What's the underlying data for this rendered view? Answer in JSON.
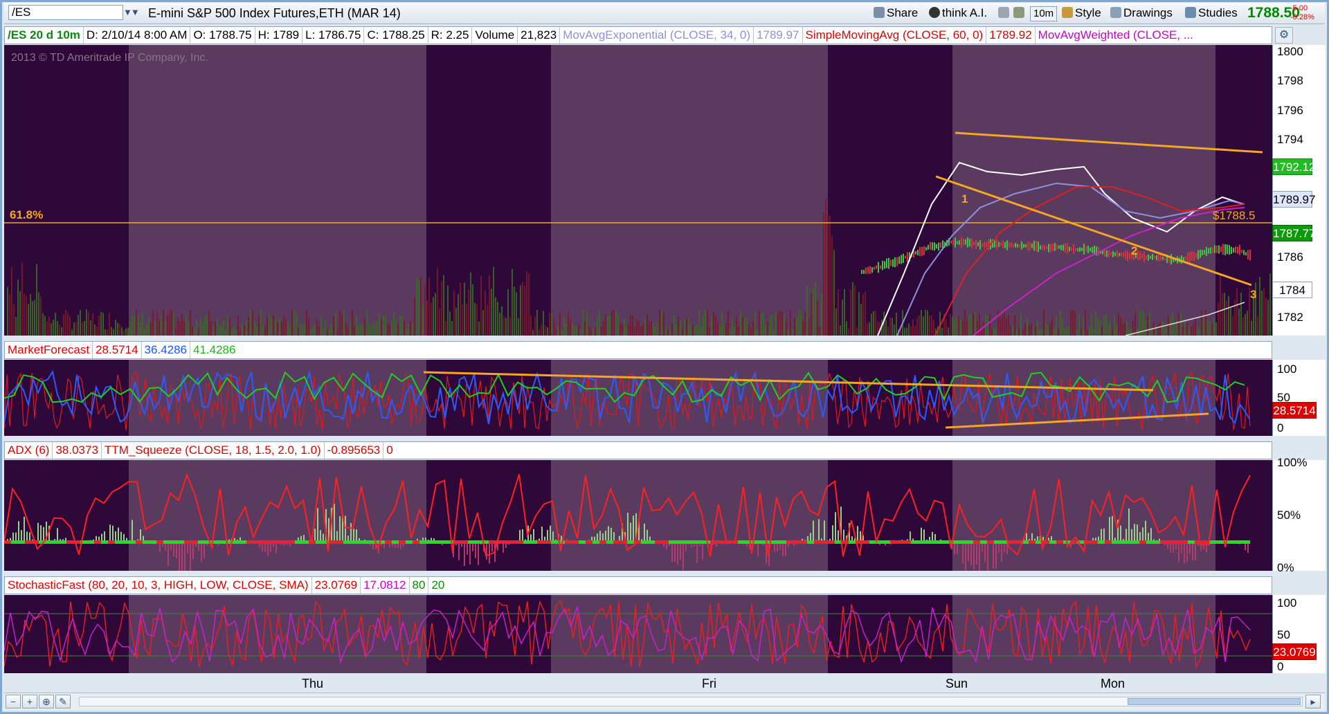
{
  "toolbar": {
    "symbol": "/ES",
    "instrument_title": "E-mini S&P 500 Index Futures,ETH (MAR 14)",
    "share_label": "Share",
    "think_ai_label": "think A.I.",
    "period_label": "10m",
    "style_label": "Style",
    "drawings_label": "Drawings",
    "studies_label": "Studies",
    "last_price": "1788.50",
    "net_change": "-5.00",
    "pct_change": "-0.28%"
  },
  "info_row": {
    "chart_id": "/ES 20 d 10m",
    "date": "D: 2/10/14 8:00 AM",
    "open": "O: 1788.75",
    "high": "H: 1789",
    "low": "L: 1786.75",
    "close": "C: 1788.25",
    "range": "R: 2.25",
    "volume_label": "Volume",
    "volume_value": "21,823",
    "ema_label": "MovAvgExponential (CLOSE, 34, 0)",
    "ema_value": "1789.97",
    "sma_label": "SimpleMovingAvg (CLOSE, 60, 0)",
    "sma_value": "1789.92",
    "wma_label": "MovAvgWeighted (CLOSE, ..."
  },
  "price_pane": {
    "copyright": "2013 © TD Ameritrade IP Company, Inc.",
    "fib_label": "61.8%",
    "annotations": [
      "1",
      "2",
      "3"
    ],
    "price_annotation": "$1788.5",
    "axis_ticks": [
      "1800",
      "1798",
      "1796",
      "1794",
      "1786",
      "1784",
      "1782"
    ],
    "tag_upper": "1792.12",
    "tag_ema": "1789.97",
    "tag_last": "1787.77",
    "tag_1784": "1784",
    "colors": {
      "background": "#2e0838",
      "session_band": "#5a3a5e",
      "trendline": "#f5a623",
      "up_bar": "#3cc83c",
      "down_bar": "#d9323f"
    }
  },
  "market_forecast": {
    "label": "MarketForecast",
    "v1": "28.5714",
    "v2": "36.4286",
    "v3": "41.4286",
    "axis_ticks": [
      "100",
      "50",
      "0"
    ],
    "tag": "28.5714"
  },
  "adx": {
    "label": "ADX (6)",
    "value": "38.0373",
    "squeeze_label": "TTM_Squeeze (CLOSE, 18, 1.5, 2.0, 1.0)",
    "squeeze_value": "-0.895653",
    "squeeze_zero": "0",
    "axis_ticks": [
      "100%",
      "50%",
      "0%"
    ]
  },
  "stochastic": {
    "label": "StochasticFast (80, 20, 10, 3, HIGH, LOW, CLOSE, SMA)",
    "k": "23.0769",
    "d": "17.0812",
    "ob": "80",
    "os": "20",
    "axis_ticks": [
      "100",
      "50",
      "0"
    ],
    "tag": "23.0769"
  },
  "x_axis": {
    "days": [
      "Thu",
      "Fri",
      "Sun",
      "Mon"
    ]
  }
}
